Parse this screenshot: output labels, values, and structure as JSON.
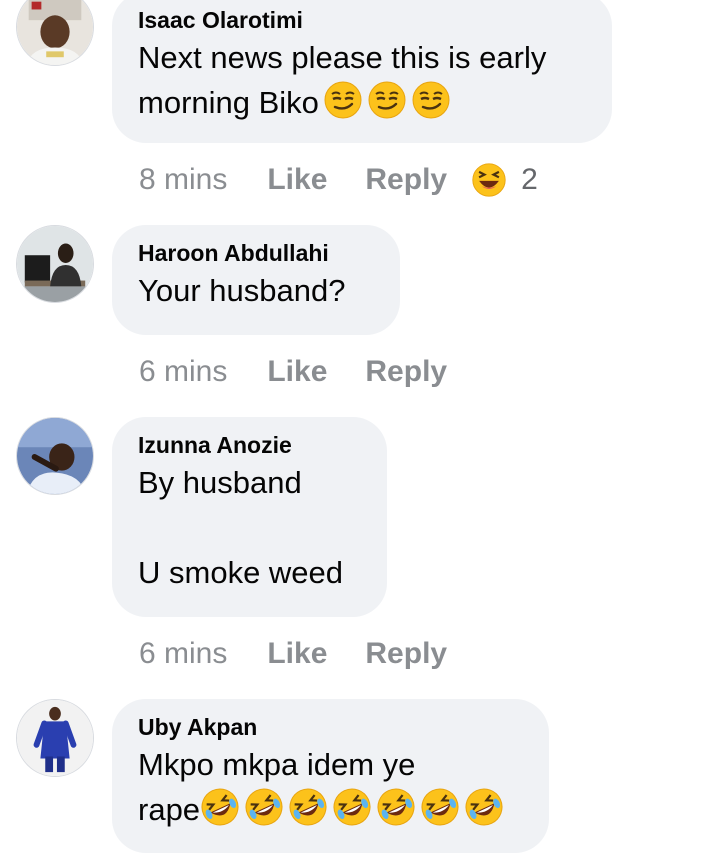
{
  "comments": [
    {
      "author": "Isaac Olarotimi",
      "text": "Next news please this is early\nmorning Biko",
      "emojis": [
        "smirk-face",
        "smirk-face",
        "smirk-face"
      ],
      "time": "8 mins",
      "like_label": "Like",
      "reply_label": "Reply",
      "reaction_icon": "laughing-squint-face",
      "reaction_count": "2"
    },
    {
      "author": "Haroon Abdullahi",
      "text": "Your husband?",
      "time": "6 mins",
      "like_label": "Like",
      "reply_label": "Reply"
    },
    {
      "author": "Izunna Anozie",
      "text": "By husband\n\nU smoke weed",
      "time": "6 mins",
      "like_label": "Like",
      "reply_label": "Reply"
    },
    {
      "author": "Uby Akpan",
      "text": "Mkpo mkpa idem ye\nrape",
      "emojis": [
        "rolling-on-floor-laughing-face",
        "rolling-on-floor-laughing-face",
        "rolling-on-floor-laughing-face",
        "rolling-on-floor-laughing-face",
        "rolling-on-floor-laughing-face",
        "rolling-on-floor-laughing-face",
        "rolling-on-floor-laughing-face"
      ]
    }
  ],
  "colors": {
    "bubble": "#f0f2f5",
    "meta_text": "#8a8d91",
    "emoji_yellow": "#fcc21b"
  }
}
